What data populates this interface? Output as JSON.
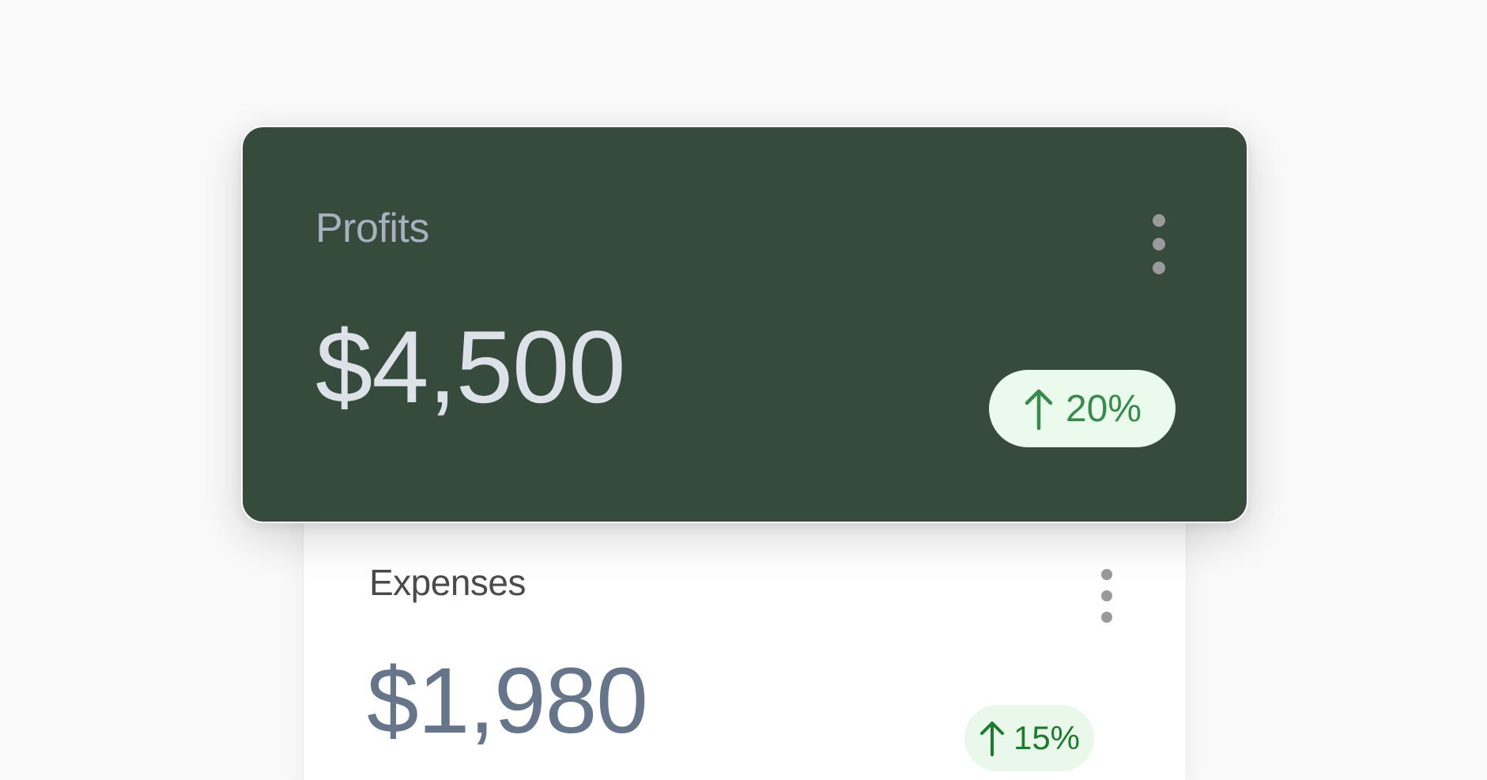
{
  "colors": {
    "background": "#fafafa",
    "profits_card": "#364b3c",
    "expenses_card": "#ffffff",
    "badge_bg": "#eafaec",
    "badge_fg": "#3a8a4e",
    "expenses_amount": "#66758a",
    "menu_dots": "#9a9a9a"
  },
  "cards": {
    "profits": {
      "label": "Profits",
      "amount": "$4,500",
      "change": "20%",
      "change_icon": "arrow-up-icon",
      "menu_icon": "kebab-menu-icon"
    },
    "expenses": {
      "label": "Expenses",
      "amount": "$1,980",
      "change": "15%",
      "change_icon": "arrow-up-icon",
      "menu_icon": "kebab-menu-icon"
    }
  }
}
